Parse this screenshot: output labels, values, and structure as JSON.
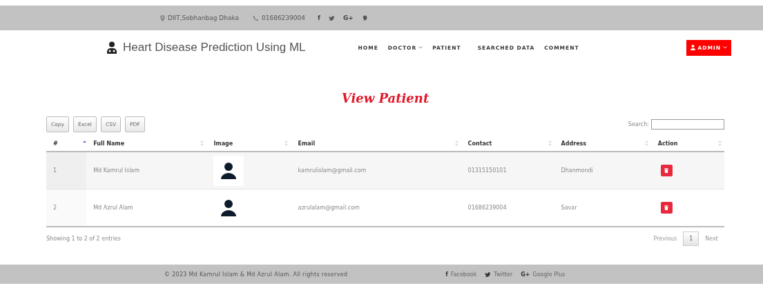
{
  "topbar": {
    "location": "DIIT,Sobhanbag Dhaka",
    "phone": "01686239004",
    "social": [
      {
        "kind": "facebook",
        "glyph": "f"
      },
      {
        "kind": "twitter"
      },
      {
        "kind": "google",
        "glyph": "G+"
      },
      {
        "kind": "pinterest"
      }
    ]
  },
  "header": {
    "brand": "Heart Disease Prediction Using ML",
    "nav": [
      {
        "label": "HOME",
        "dropdown": false
      },
      {
        "label": "DOCTOR",
        "dropdown": true
      },
      {
        "label": "PATIENT",
        "dropdown": false
      },
      {
        "label": "SEARCHED DATA",
        "dropdown": false
      },
      {
        "label": "COMMENT",
        "dropdown": false
      }
    ],
    "user_button": "ADMIN"
  },
  "page_title": "View Patient",
  "export_buttons": [
    "Copy",
    "Excel",
    "CSV",
    "PDF"
  ],
  "search": {
    "label": "Search:"
  },
  "table": {
    "columns": [
      {
        "label": "#",
        "sorted": true
      },
      {
        "label": "Full Name",
        "sorted": false
      },
      {
        "label": "Image",
        "sorted": false
      },
      {
        "label": "Email",
        "sorted": false
      },
      {
        "label": "Contact",
        "sorted": false
      },
      {
        "label": "Address",
        "sorted": false
      },
      {
        "label": "Action",
        "sorted": false
      }
    ],
    "rows": [
      {
        "index": "1",
        "name": "Md Kamrul Islam",
        "email": "kamrulislam@gmail.com",
        "contact": "01315150101",
        "address": "Dhanmondi"
      },
      {
        "index": "2",
        "name": "Md Azrul Alam",
        "email": "azrulalam@gmail.com",
        "contact": "01686239004",
        "address": "Savar"
      }
    ]
  },
  "info": "Showing 1 to 2 of 2 entries",
  "pagination": [
    {
      "label": "Previous",
      "selected": false
    },
    {
      "label": "1",
      "selected": true
    },
    {
      "label": "Next",
      "selected": false
    }
  ],
  "footer": {
    "copyright": "© 2023 Md Kamrul Islam & Md Azrul Alam. All rights reserved",
    "links": [
      {
        "kind": "facebook",
        "glyph": "f",
        "label": "Facebook"
      },
      {
        "kind": "twitter",
        "label": "Twitter"
      },
      {
        "kind": "google",
        "glyph": "G+",
        "label": "Google Plus"
      }
    ]
  }
}
